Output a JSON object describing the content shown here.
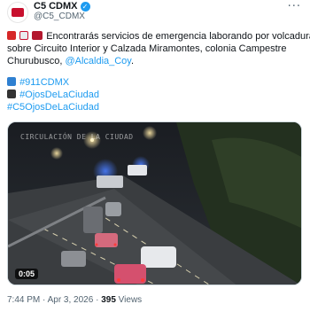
{
  "author": {
    "display_name": "C5 CDMX",
    "handle": "@C5_CDMX"
  },
  "tweet": {
    "line1": "Encontrarás servicios de emergencia laborando por volcadura",
    "line2": "sobre Circuito Interior y Calzada Miramontes, colonia Campestre",
    "line3_prefix": "Churubusco, ",
    "mention": "@Alcaldia_Coy",
    "line3_suffix": ".",
    "hashtag1": "#911CDMX",
    "hashtag2": "#OjosDeLaCiudad",
    "hashtag3": "#C5OjosDeLaCiudad"
  },
  "media": {
    "duration": "0:05",
    "overlay_text": "CIRCULACIÓN DE LA CIUDAD"
  },
  "meta": {
    "time": "7:44 PM",
    "separator1": " · ",
    "date": "Apr 3, 2026",
    "separator2": " · ",
    "views_count": "395",
    "views_label": " Views"
  },
  "icons": {
    "verified": "verified-badge-icon",
    "more": "more-options-icon"
  },
  "colors": {
    "link": "#1d9bf0",
    "text": "#0f1419",
    "muted": "#536471",
    "brand": "#c8102e"
  }
}
